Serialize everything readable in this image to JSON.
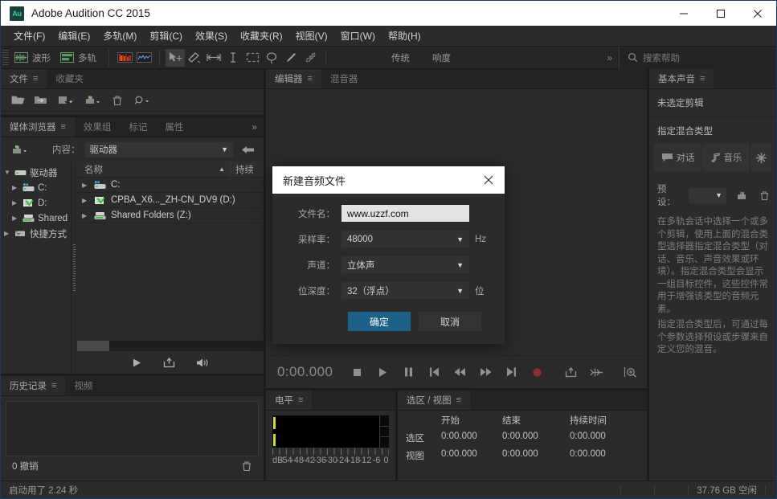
{
  "window": {
    "app_abbrev": "Au",
    "title": "Adobe Audition CC 2015",
    "minimize": "—",
    "maximize": "□",
    "close": "✕"
  },
  "menubar": {
    "items": [
      {
        "label": "文件(F)"
      },
      {
        "label": "编辑(E)"
      },
      {
        "label": "多轨(M)"
      },
      {
        "label": "剪辑(C)"
      },
      {
        "label": "效果(S)"
      },
      {
        "label": "收藏夹(R)"
      },
      {
        "label": "视图(V)"
      },
      {
        "label": "窗口(W)"
      },
      {
        "label": "帮助(H)"
      }
    ]
  },
  "toolbar": {
    "waveform_label": "波形",
    "multitrack_label": "多轨",
    "workspaces": [
      {
        "label": "传统"
      },
      {
        "label": "响度"
      }
    ],
    "overflow": "»",
    "search_placeholder": "搜索帮助"
  },
  "files_panel": {
    "tabs": [
      {
        "label": "文件",
        "active": true
      },
      {
        "label": "收藏夹",
        "active": false
      }
    ]
  },
  "media_browser": {
    "tabs": [
      {
        "label": "媒体浏览器",
        "active": true
      },
      {
        "label": "效果组",
        "active": false
      },
      {
        "label": "标记",
        "active": false
      },
      {
        "label": "属性",
        "active": false
      }
    ],
    "overflow": "»",
    "content_label": "内容：",
    "content_value": "驱动器",
    "tree": [
      {
        "label": "驱动器",
        "expanded": true
      },
      {
        "label": "C:",
        "expanded": false
      },
      {
        "label": "D:",
        "expanded": false
      },
      {
        "label": "Shared",
        "expanded": false
      },
      {
        "label": "快捷方式",
        "expanded": false
      }
    ],
    "columns": [
      {
        "label": "名称"
      },
      {
        "label": "持续"
      }
    ],
    "rows": [
      {
        "name": "C:"
      },
      {
        "name": "CPBA_X6..._ZH-CN_DV9 (D:)"
      },
      {
        "name": "Shared Folders (Z:)"
      }
    ]
  },
  "history_panel": {
    "tabs": [
      {
        "label": "历史记录",
        "active": true
      },
      {
        "label": "视频",
        "active": false
      }
    ],
    "undo_count": "0 撤销"
  },
  "editor_panel": {
    "tabs": [
      {
        "label": "编辑器",
        "active": true
      },
      {
        "label": "混音器",
        "active": false
      }
    ],
    "timecode": "0:00.000"
  },
  "levels_panel": {
    "tabs": [
      {
        "label": "电平",
        "active": true
      }
    ],
    "unit": "dB",
    "ticks": [
      "-54",
      "-48",
      "-42",
      "-36",
      "-30",
      "-24",
      "-18",
      "-12",
      "-6",
      "0"
    ]
  },
  "selection_panel": {
    "tabs": [
      {
        "label": "选区 / 视图",
        "active": true
      }
    ],
    "headers": [
      "开始",
      "结束",
      "持续时间"
    ],
    "rows": [
      {
        "label": "选区",
        "start": "0:00.000",
        "end": "0:00.000",
        "duration": "0:00.000"
      },
      {
        "label": "视图",
        "start": "0:00.000",
        "end": "0:00.000",
        "duration": "0:00.000"
      }
    ]
  },
  "essential_sound": {
    "tabs": [
      {
        "label": "基本声音",
        "active": true
      }
    ],
    "no_clip_selected": "未选定剪辑",
    "assign_mix_type": "指定混合类型",
    "types": [
      {
        "label": "对话",
        "icon": "speech-bubble-icon"
      },
      {
        "label": "音乐",
        "icon": "music-note-icon"
      },
      {
        "label": "",
        "icon": "sparkle-icon"
      }
    ],
    "preset_label": "预设：",
    "preset_value": "",
    "description": "在多轨会话中选择一个或多个剪辑，使用上面的混合类型选择器指定混合类型（对话、音乐、声音效果或环境）。指定混合类型会显示一组目标控件，这些控件常用于增强该类型的音频元素。",
    "description2": "指定混合类型后，可通过每个参数选择预设或步骤来自定义您的混音。"
  },
  "statusbar": {
    "startup": "启动用了 2.24 秒",
    "free_space": "37.76 GB 空闲"
  },
  "dialog": {
    "title": "新建音频文件",
    "close": "✕",
    "filename_label": "文件名：",
    "filename_value": "www.uzzf.com",
    "samplerate_label": "采样率：",
    "samplerate_value": "48000",
    "samplerate_unit": "Hz",
    "channels_label": "声道：",
    "channels_value": "立体声",
    "bitdepth_label": "位深度：",
    "bitdepth_value": "32（浮点）",
    "bitdepth_unit": "位",
    "ok_label": "确定",
    "cancel_label": "取消"
  },
  "colors": {
    "accent": "#1d6189",
    "titlebar_bg": "#ffffff",
    "panel_bg": "#2b2b2b",
    "meter_yellow": "#d8d821",
    "record_red": "#8c2f2f"
  }
}
